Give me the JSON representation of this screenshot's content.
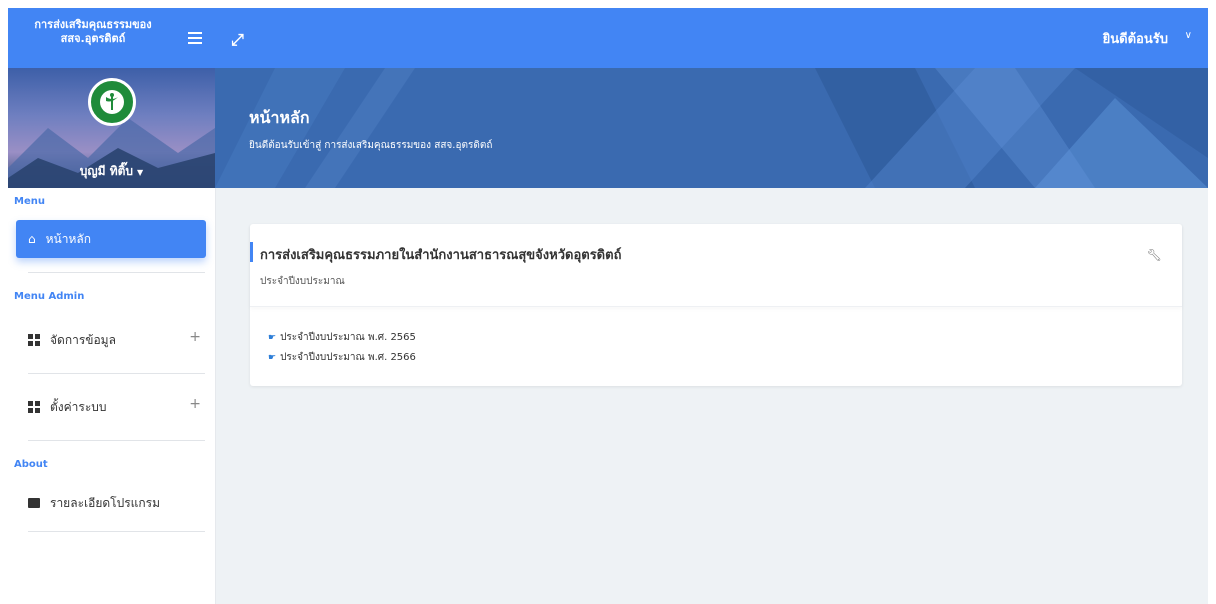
{
  "sidebar": {
    "brand_title": "การส่งเสริมคุณธรรมของ สสจ.อุตรดิตถ์",
    "user_name": "บุญมี ทิติ๊บ",
    "section_menu": "Menu",
    "section_admin": "Menu Admin",
    "section_about": "About",
    "items": [
      {
        "label": "หน้าหลัก",
        "icon": "home-icon"
      },
      {
        "label": "จัดการข้อมูล",
        "icon": "grid-icon"
      },
      {
        "label": "ตั้งค่าระบบ",
        "icon": "grid-icon"
      },
      {
        "label": "รายละเอียดโปรแกรม",
        "icon": "id-card-icon"
      }
    ]
  },
  "topbar": {
    "welcome": "ยินดีต้อนรับ",
    "expand_icon": "expand-icon",
    "menu_icon": "hamburger-icon"
  },
  "banner": {
    "title": "หน้าหลัก",
    "subtitle": "ยินดีต้อนรับเข้าสู่ การส่งเสริมคุณธรรมของ สสจ.อุตรดิตถ์"
  },
  "card": {
    "title": "การส่งเสริมคุณธรรมภายในสำนักงานสาธารณสุขจังหวัดอุตรดิตถ์",
    "subtitle": "ประจำปีงบประมาณ",
    "links": [
      "ประจำปีงบประมาณ พ.ศ. 2565",
      "ประจำปีงบประมาณ พ.ศ. 2566"
    ]
  },
  "colors": {
    "accent": "#4285f4",
    "banner": "#3a6ab0"
  }
}
